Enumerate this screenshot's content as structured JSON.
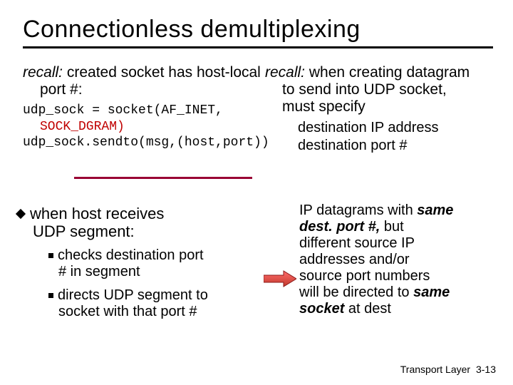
{
  "title": "Connectionless demultiplexing",
  "upper": {
    "left": {
      "recall_prefix": "recall:",
      "recall_text": " created socket has host-local",
      "port_line": "port #:",
      "code1a": "udp_sock = socket(AF_INET,",
      "code1b": "SOCK_DGRAM)",
      "code2": "udp_sock.sendto(msg,(host,port))"
    },
    "right": {
      "recall_prefix": "recall:",
      "recall_text": " when creating datagram",
      "line2": "to send into UDP socket,",
      "line3": "must specify",
      "sub1": "destination IP address",
      "sub2": "destination port #"
    }
  },
  "lower": {
    "left": {
      "main1": "when host receives",
      "main2": "UDP segment:",
      "sub1a": "checks destination port",
      "sub1b": "# in segment",
      "sub2a": "directs UDP segment to",
      "sub2b": "socket with that port #"
    },
    "right": {
      "l1a": "IP datagrams with ",
      "l1b": "same",
      "l2a": "dest. port #,",
      "l2b": " but",
      "l3": "different source IP",
      "l4": "addresses and/or",
      "l5": "source port numbers",
      "l6a": "will be directed to ",
      "l6b": "same",
      "l7a": "socket",
      "l7b": " at dest"
    }
  },
  "footer": {
    "label": "Transport Layer",
    "page": "3-13"
  }
}
